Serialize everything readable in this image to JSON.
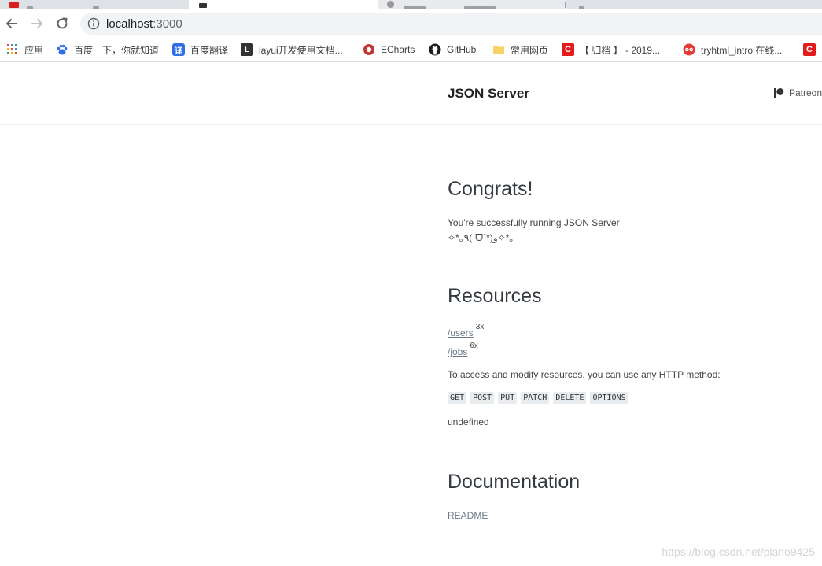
{
  "browser": {
    "url_host": "localhost",
    "url_port": ":3000",
    "bookmarks": [
      {
        "label": "应用",
        "icon": "apps-grid-icon"
      },
      {
        "label": "百度一下，你就知道",
        "icon": "baidu-paw-icon"
      },
      {
        "label": "百度翻译",
        "icon": "translate-icon"
      },
      {
        "label": "layui开发使用文档...",
        "icon": "layui-icon"
      },
      {
        "label": "ECharts",
        "icon": "echarts-icon"
      },
      {
        "label": "GitHub",
        "icon": "github-icon"
      },
      {
        "label": "常用网页",
        "icon": "folder-icon"
      },
      {
        "label": "【 归档 】 - 2019...",
        "icon": "csdn-icon"
      },
      {
        "label": "tryhtml_intro 在线...",
        "icon": "runoob-icon"
      }
    ]
  },
  "header": {
    "brand": "JSON Server",
    "patreon": "Patreon"
  },
  "congrats": {
    "title": "Congrats!",
    "line1": "You're successfully running JSON Server",
    "line2": "✧*｡٩(ˊᗜˋ*)و✧*｡"
  },
  "resources": {
    "title": "Resources",
    "items": [
      {
        "path": "/users",
        "count": "3x"
      },
      {
        "path": "/jobs",
        "count": "6x"
      }
    ],
    "access_text": "To access and modify resources, you can use any HTTP method:",
    "methods": [
      "GET",
      "POST",
      "PUT",
      "PATCH",
      "DELETE",
      "OPTIONS"
    ],
    "undefined_text": "undefined"
  },
  "documentation": {
    "title": "Documentation",
    "readme": "README"
  },
  "watermark": "https://blog.csdn.net/piano9425"
}
